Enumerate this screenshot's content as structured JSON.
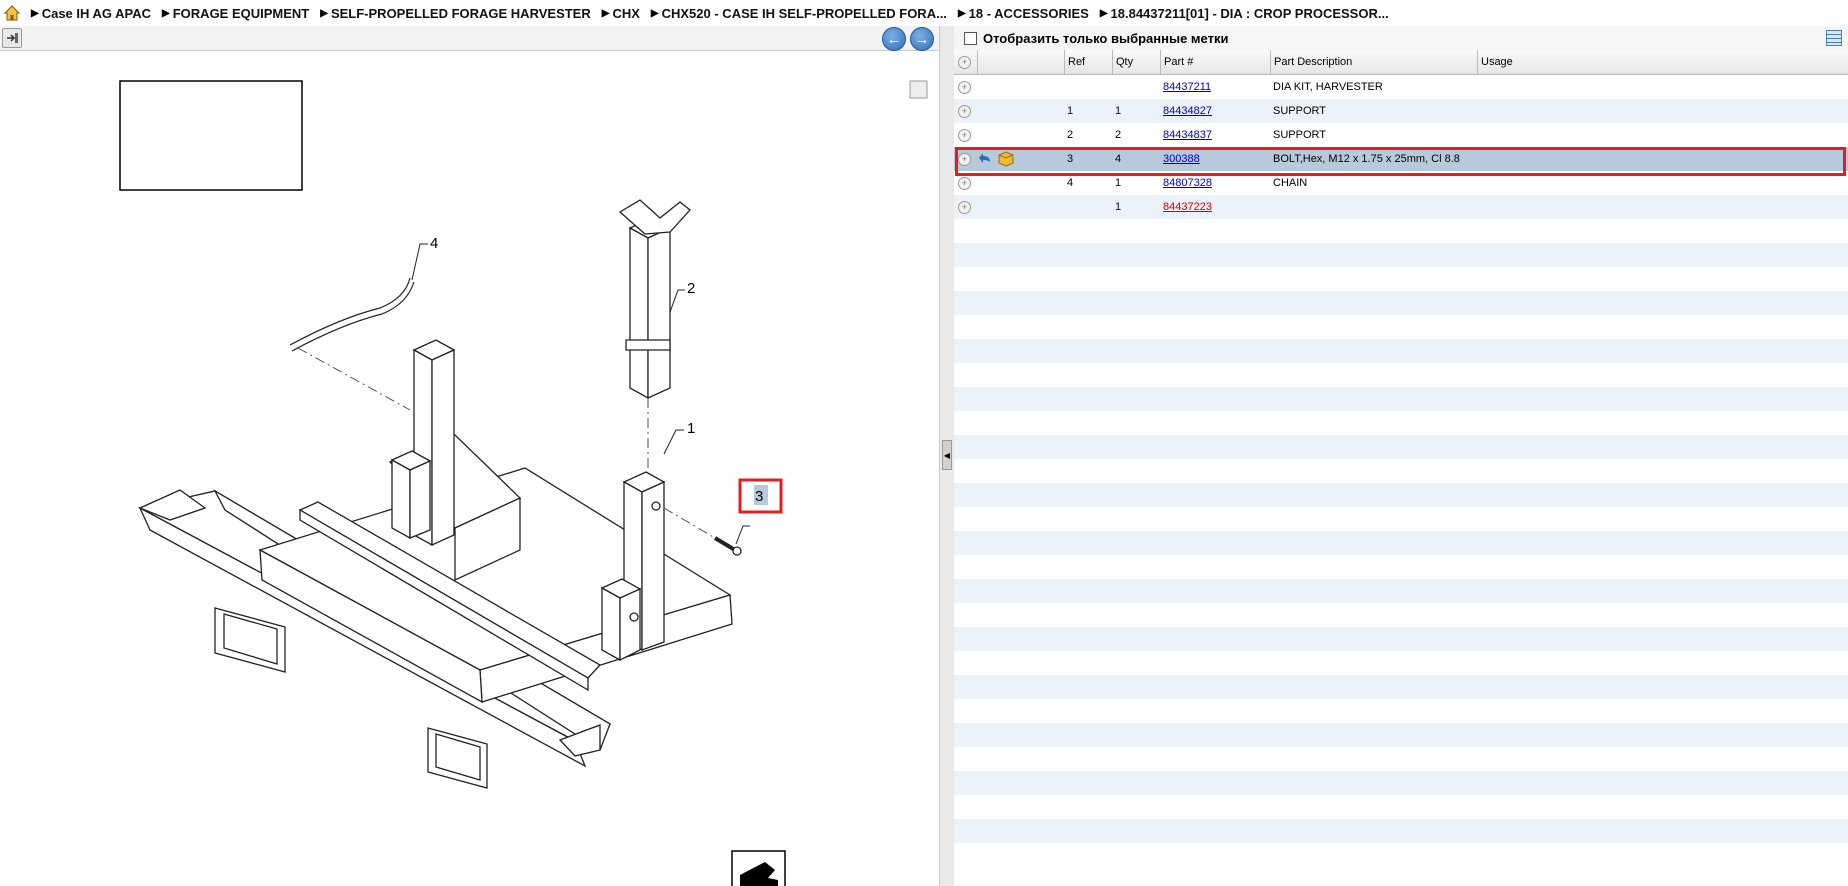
{
  "breadcrumb": [
    "Case IH AG APAC",
    "FORAGE EQUIPMENT",
    "SELF-PROPELLED FORAGE HARVESTER",
    "CHX",
    "CHX520 - CASE IH SELF-PROPELLED FORA...",
    "18 - ACCESSORIES",
    "18.84437211[01] - DIA : CROP PROCESSOR..."
  ],
  "diagram": {
    "callouts": [
      "4",
      "2",
      "1",
      "3"
    ],
    "highlighted_callout": "3"
  },
  "filter": {
    "label": "Отобразить только выбранные метки",
    "checked": false
  },
  "table": {
    "headers": {
      "ref": "Ref",
      "qty": "Qty",
      "part": "Part #",
      "desc": "Part Description",
      "usage": "Usage"
    },
    "rows": [
      {
        "ref": "",
        "qty": "",
        "part": "84437211",
        "desc": "DIA KIT, HARVESTER",
        "usage": "",
        "link_color": "blue"
      },
      {
        "ref": "1",
        "qty": "1",
        "part": "84434827",
        "desc": "SUPPORT",
        "usage": "",
        "link_color": "blue"
      },
      {
        "ref": "2",
        "qty": "2",
        "part": "84434837",
        "desc": "SUPPORT",
        "usage": "",
        "link_color": "blue"
      },
      {
        "ref": "3",
        "qty": "4",
        "part": "300388",
        "desc": "BOLT,Hex, M12 x 1.75 x 25mm, Cl 8.8",
        "usage": "",
        "link_color": "blue",
        "selected": true
      },
      {
        "ref": "4",
        "qty": "1",
        "part": "84807328",
        "desc": "CHAIN",
        "usage": "",
        "link_color": "blue"
      },
      {
        "ref": "",
        "qty": "1",
        "part": "84437223",
        "desc": "",
        "usage": "",
        "link_color": "red"
      }
    ]
  },
  "colors": {
    "selected_row": "#b7cadb",
    "highlight": "#e02020",
    "link": "#0000cc",
    "link_red": "#d40000",
    "stripe": "#edf2f8"
  }
}
